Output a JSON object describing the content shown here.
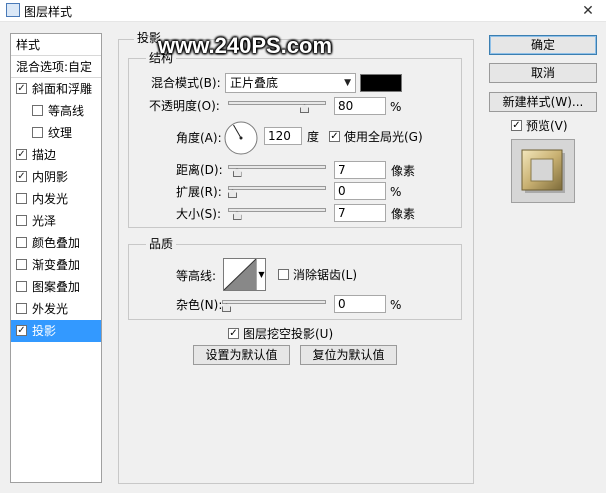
{
  "window": {
    "title": "图层样式",
    "close_glyph": "✕"
  },
  "watermark": "www.240PS.com",
  "left_panel": {
    "header": "样式",
    "blend_options": "混合选项:自定",
    "items": [
      {
        "label": "斜面和浮雕",
        "checked": true,
        "indent": false
      },
      {
        "label": "等高线",
        "checked": false,
        "indent": true
      },
      {
        "label": "纹理",
        "checked": false,
        "indent": true
      },
      {
        "label": "描边",
        "checked": true,
        "indent": false
      },
      {
        "label": "内阴影",
        "checked": true,
        "indent": false
      },
      {
        "label": "内发光",
        "checked": false,
        "indent": false
      },
      {
        "label": "光泽",
        "checked": false,
        "indent": false
      },
      {
        "label": "颜色叠加",
        "checked": false,
        "indent": false
      },
      {
        "label": "渐变叠加",
        "checked": false,
        "indent": false
      },
      {
        "label": "图案叠加",
        "checked": false,
        "indent": false
      },
      {
        "label": "外发光",
        "checked": false,
        "indent": false
      },
      {
        "label": "投影",
        "checked": true,
        "indent": false,
        "selected": true
      }
    ]
  },
  "drop_shadow": {
    "section_title": "投影",
    "structure_title": "结构",
    "blend_mode_label": "混合模式(B):",
    "blend_mode_value": "正片叠底",
    "shadow_color": "#000000",
    "opacity_label": "不透明度(O):",
    "opacity_value": "80",
    "opacity_unit": "%",
    "opacity_fraction": 0.8,
    "angle_label": "角度(A):",
    "angle_value": "120",
    "angle_unit": "度",
    "global_light_label": "使用全局光(G)",
    "global_light_checked": true,
    "distance_label": "距离(D):",
    "distance_value": "7",
    "distance_unit": "像素",
    "distance_fraction": 0.05,
    "spread_label": "扩展(R):",
    "spread_value": "0",
    "spread_unit": "%",
    "spread_fraction": 0.0,
    "size_label": "大小(S):",
    "size_value": "7",
    "size_unit": "像素",
    "size_fraction": 0.05,
    "quality_title": "品质",
    "contour_label": "等高线:",
    "anti_alias_label": "消除锯齿(L)",
    "anti_alias_checked": false,
    "noise_label": "杂色(N):",
    "noise_value": "0",
    "noise_unit": "%",
    "noise_fraction": 0.0,
    "knockout_label": "图层挖空投影(U)",
    "knockout_checked": true,
    "make_default_label": "设置为默认值",
    "reset_default_label": "复位为默认值"
  },
  "right_panel": {
    "ok_label": "确定",
    "cancel_label": "取消",
    "new_style_label": "新建样式(W)...",
    "preview_label": "预览(V)",
    "preview_checked": true
  },
  "colors": {
    "selection": "#3399ff",
    "gold_light": "#e8d9a8",
    "gold_dark": "#8a7a4a"
  },
  "icons": {
    "check": "✓",
    "dropdown": "chevron-down-icon",
    "close": "close-icon"
  }
}
